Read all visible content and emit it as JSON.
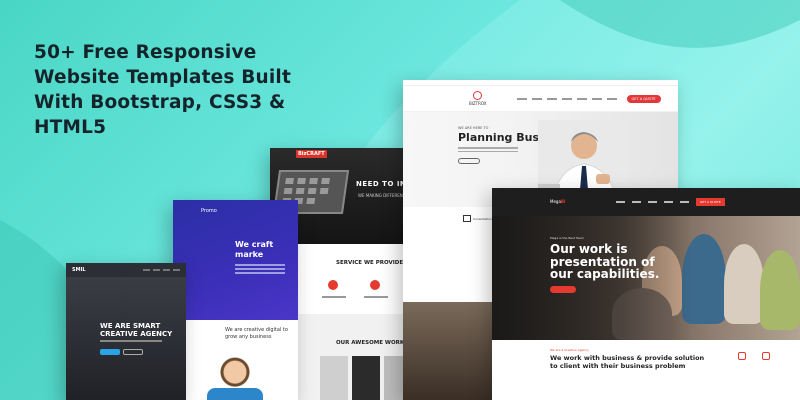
{
  "headline": {
    "line1": "50+ Free Responsive",
    "line2": "Website Templates Built",
    "line3": "With Bootstrap, CSS3 &",
    "line4": "HTML5"
  },
  "templates": {
    "smart": {
      "logo": "SMIL",
      "title": "WE ARE SMART CREATIVE AGENCY"
    },
    "promo": {
      "logo": "Promo",
      "title": "We craft marke",
      "body": "We are creative digital to grow any business"
    },
    "bizcraft": {
      "brand": "BizCRAFT",
      "hero_title": "NEED TO INV",
      "hero_sub": "WE MAKING DIFFEREN",
      "services_title": "SERVICE WE PROVIDE",
      "works_title": "OUR AWESOME WORK"
    },
    "biztrox": {
      "logo": "BIZTROX",
      "quote_button": "GET A QUOTE",
      "tag": "WE ARE HERE TO",
      "title": "Planning Business",
      "consultation_label": "Consultation"
    },
    "mega": {
      "logo": "Mega",
      "logo_accent": "Bl",
      "cta": "GET A QUOTE",
      "kicker": "Mega is the Best Team",
      "title": "Our work is presentation of our capabilities.",
      "small_label": "We are a Creative Agency",
      "subtitle": "We work with business & provide solution to client with their business problem"
    }
  },
  "colors": {
    "accent_red": "#e1383a",
    "promo_blue": "#2c2fa6",
    "smart_button": "#2aa4e6",
    "background_teal": "#49d6c4"
  }
}
